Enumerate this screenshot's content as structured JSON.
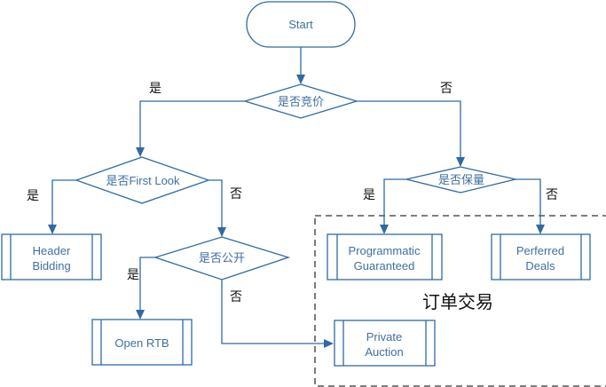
{
  "nodes": {
    "start": "Start",
    "bidding_decision": "是否竞价",
    "first_look_decision": "是否First Look",
    "guarantee_decision": "是否保量",
    "public_decision": "是否公开",
    "header_bidding": [
      "Header",
      "Bidding"
    ],
    "open_rtb": "Open RTB",
    "programmatic_guaranteed": [
      "Programmatic",
      "Guaranteed"
    ],
    "preferred_deals": [
      "Perferred",
      "Deals"
    ],
    "private_auction": [
      "Private",
      "Auction"
    ]
  },
  "branch_labels": {
    "yes": "是",
    "no": "否"
  },
  "group": {
    "label": "订单交易"
  }
}
